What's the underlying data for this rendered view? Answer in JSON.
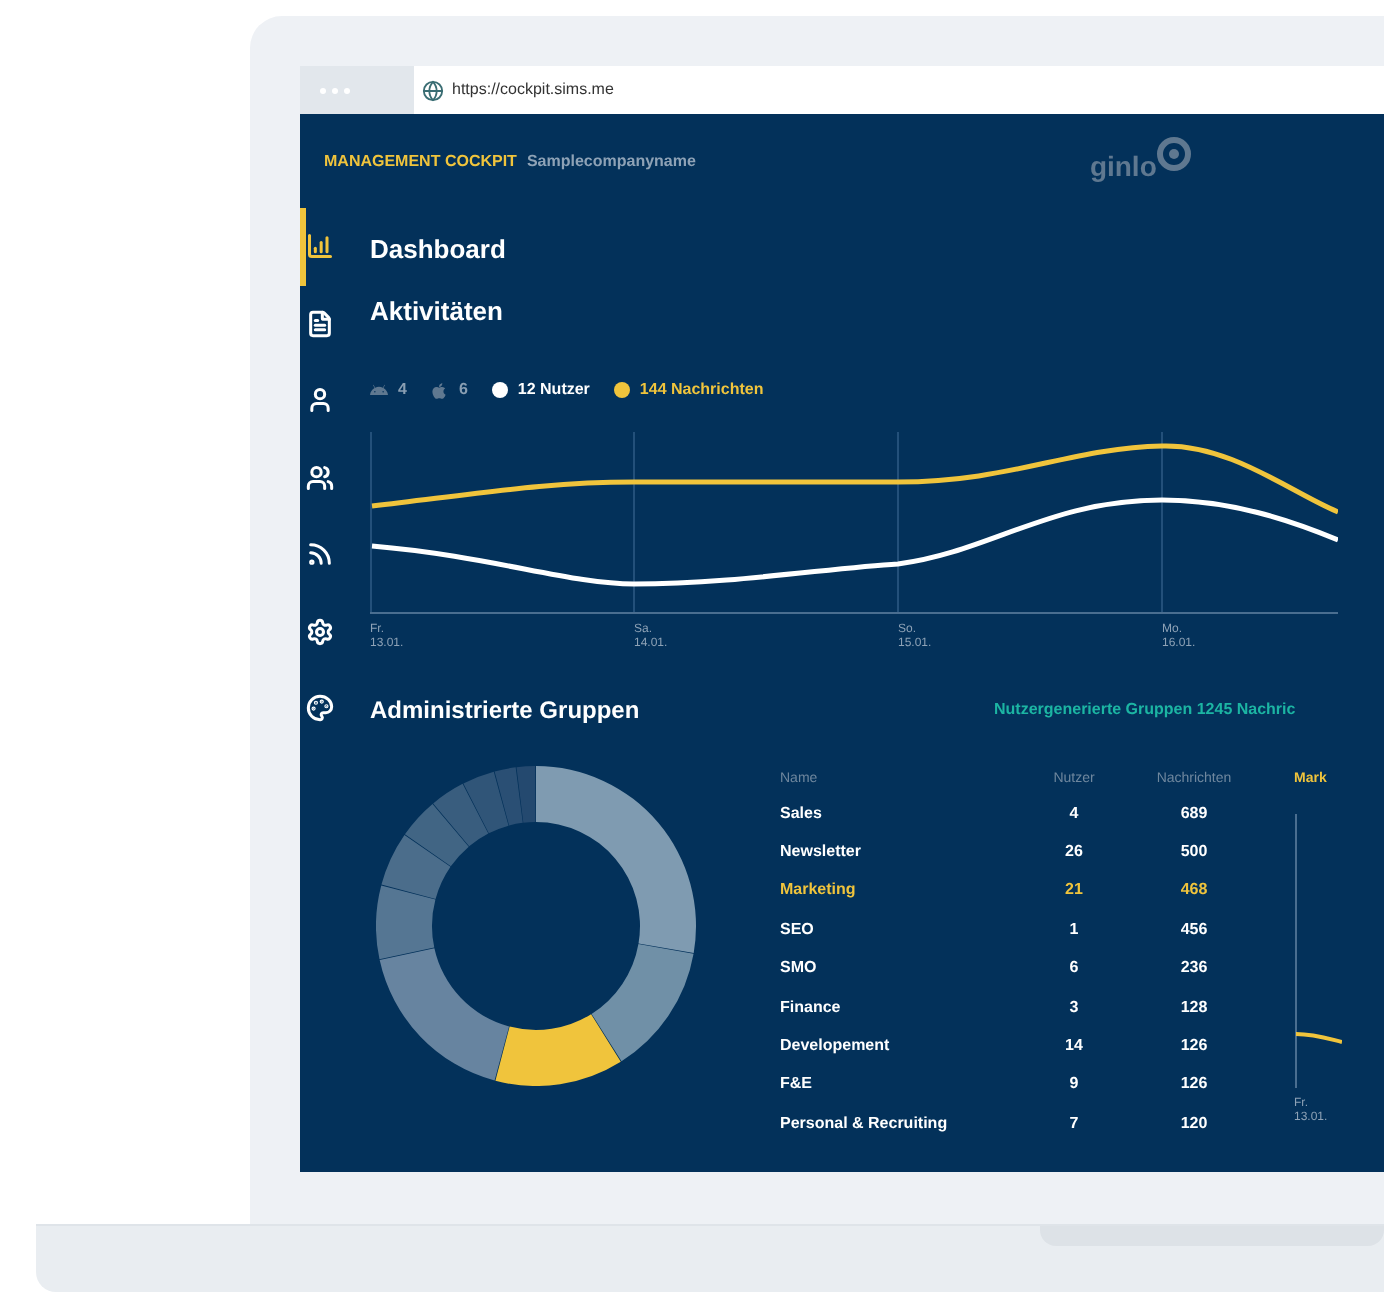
{
  "browser": {
    "url": "https://cockpit.sims.me"
  },
  "header": {
    "title": "MANAGEMENT COCKPIT",
    "company": "Samplecompanyname",
    "logo": "ginlo"
  },
  "sidebar": {
    "items": [
      {
        "kind": "chart",
        "selected": true
      },
      {
        "kind": "document",
        "selected": false
      },
      {
        "kind": "user",
        "selected": false
      },
      {
        "kind": "users",
        "selected": false
      },
      {
        "kind": "feed",
        "selected": false
      },
      {
        "kind": "settings",
        "selected": false
      },
      {
        "kind": "palette",
        "selected": false
      }
    ]
  },
  "page_title": "Dashboard",
  "activities": {
    "title": "Aktivitäten",
    "legend": [
      {
        "kind": "android",
        "label": "4"
      },
      {
        "kind": "apple",
        "label": "6"
      },
      {
        "kind": "dot",
        "label": "12 Nutzer",
        "color": "#ffffff"
      },
      {
        "kind": "dot",
        "label": "144 Nachrichten",
        "color": "#f0c43c"
      }
    ],
    "x_labels": [
      {
        "day": "Fr.",
        "date": "13.01."
      },
      {
        "day": "Sa.",
        "date": "14.01."
      },
      {
        "day": "So.",
        "date": "15.01."
      },
      {
        "day": "Mo.",
        "date": "16.01."
      }
    ]
  },
  "groups": {
    "title": "Administrierte Gruppen",
    "user_groups_title": "Nutzergenerierte Gruppen 1245 Nachric",
    "columns": [
      "Name",
      "Nutzer",
      "Nachrichten"
    ],
    "rows": [
      {
        "name": "Sales",
        "users": "4",
        "messages": "689",
        "selected": false
      },
      {
        "name": "Newsletter",
        "users": "26",
        "messages": "500",
        "selected": false
      },
      {
        "name": "Marketing",
        "users": "21",
        "messages": "468",
        "selected": true
      },
      {
        "name": "SEO",
        "users": "1",
        "messages": "456",
        "selected": false
      },
      {
        "name": "SMO",
        "users": "6",
        "messages": "236",
        "selected": false
      },
      {
        "name": "Finance",
        "users": "3",
        "messages": "128",
        "selected": false
      },
      {
        "name": "Developement",
        "users": "14",
        "messages": "126",
        "selected": false
      },
      {
        "name": "F&E",
        "users": "9",
        "messages": "126",
        "selected": false
      },
      {
        "name": "Personal & Recruiting",
        "users": "7",
        "messages": "120",
        "selected": false
      }
    ],
    "detail_chart": {
      "title": "Mark",
      "x_label": {
        "day": "Fr.",
        "date": "13.01."
      }
    }
  }
}
